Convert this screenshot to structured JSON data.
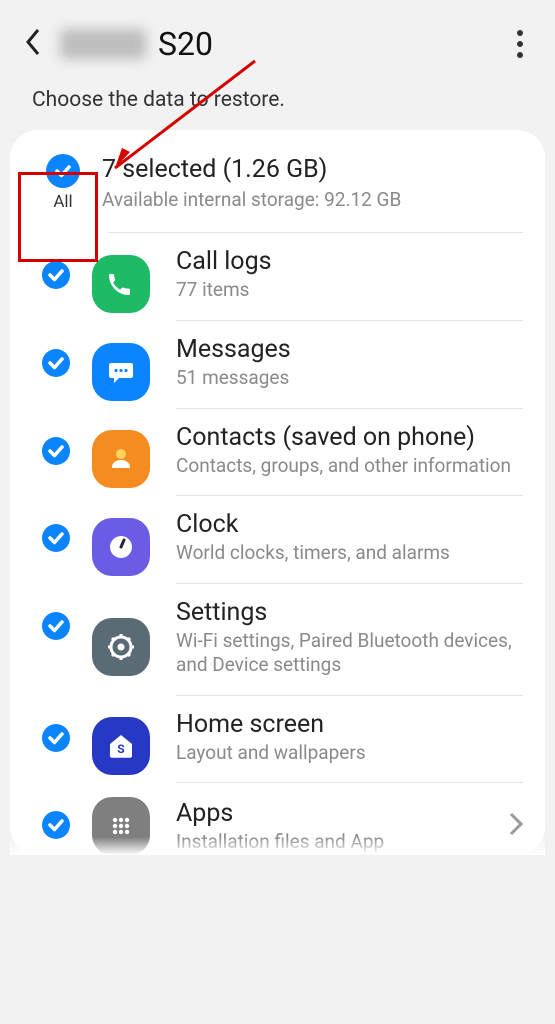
{
  "header": {
    "device_name_suffix": "S20"
  },
  "instruction": "Choose the data to restore.",
  "summary": {
    "title": "7 selected (1.26 GB)",
    "subtitle": "Available internal storage: 92.12 GB",
    "all_label": "All"
  },
  "items": [
    {
      "key": "calllogs",
      "title": "Call logs",
      "subtitle": "77 items",
      "checked": true
    },
    {
      "key": "messages",
      "title": "Messages",
      "subtitle": "51 messages",
      "checked": true
    },
    {
      "key": "contacts",
      "title": "Contacts (saved on phone)",
      "subtitle": "Contacts, groups, and other information",
      "checked": true
    },
    {
      "key": "clock",
      "title": "Clock",
      "subtitle": "World clocks, timers, and alarms",
      "checked": true
    },
    {
      "key": "settings",
      "title": "Settings",
      "subtitle": "Wi-Fi settings, Paired Bluetooth devices, and Device settings",
      "checked": true
    },
    {
      "key": "homescreen",
      "title": "Home screen",
      "subtitle": "Layout and wallpapers",
      "checked": true
    },
    {
      "key": "apps",
      "title": "Apps",
      "subtitle": "Installation files and App",
      "checked": true
    }
  ]
}
